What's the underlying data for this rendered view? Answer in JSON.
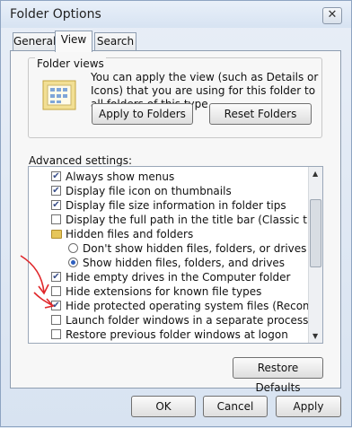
{
  "window": {
    "title": "Folder Options",
    "close_symbol": "✕"
  },
  "tabs": [
    {
      "label": "General"
    },
    {
      "label": "View"
    },
    {
      "label": "Search"
    }
  ],
  "folder_views": {
    "legend": "Folder views",
    "description": "You can apply the view (such as Details or Icons) that you are using for this folder to all folders of this type.",
    "apply_button": "Apply to Folders",
    "reset_button": "Reset Folders"
  },
  "advanced": {
    "label": "Advanced settings:",
    "items": [
      {
        "label": "Always show menus",
        "kind": "checkbox",
        "checked": true
      },
      {
        "label": "Display file icon on thumbnails",
        "kind": "checkbox",
        "checked": true
      },
      {
        "label": "Display file size information in folder tips",
        "kind": "checkbox",
        "checked": true
      },
      {
        "label": "Display the full path in the title bar (Classic theme only)",
        "kind": "checkbox",
        "checked": false
      },
      {
        "label": "Hidden files and folders",
        "kind": "folder"
      },
      {
        "label": "Don't show hidden files, folders, or drives",
        "kind": "radio",
        "checked": false
      },
      {
        "label": "Show hidden files, folders, and drives",
        "kind": "radio",
        "checked": true
      },
      {
        "label": "Hide empty drives in the Computer folder",
        "kind": "checkbox",
        "checked": true
      },
      {
        "label": "Hide extensions for known file types",
        "kind": "checkbox",
        "checked": false
      },
      {
        "label": "Hide protected operating system files (Recommended)",
        "kind": "checkbox",
        "checked": true
      },
      {
        "label": "Launch folder windows in a separate process",
        "kind": "checkbox",
        "checked": false
      },
      {
        "label": "Restore previous folder windows at logon",
        "kind": "checkbox",
        "checked": false
      }
    ],
    "check_glyph": "✔"
  },
  "restore_button": "Restore Defaults",
  "footer": {
    "ok": "OK",
    "cancel": "Cancel",
    "apply": "Apply"
  },
  "colors": {
    "annotation_arrow": "#e0262a",
    "accent": "#2d5fbf"
  }
}
